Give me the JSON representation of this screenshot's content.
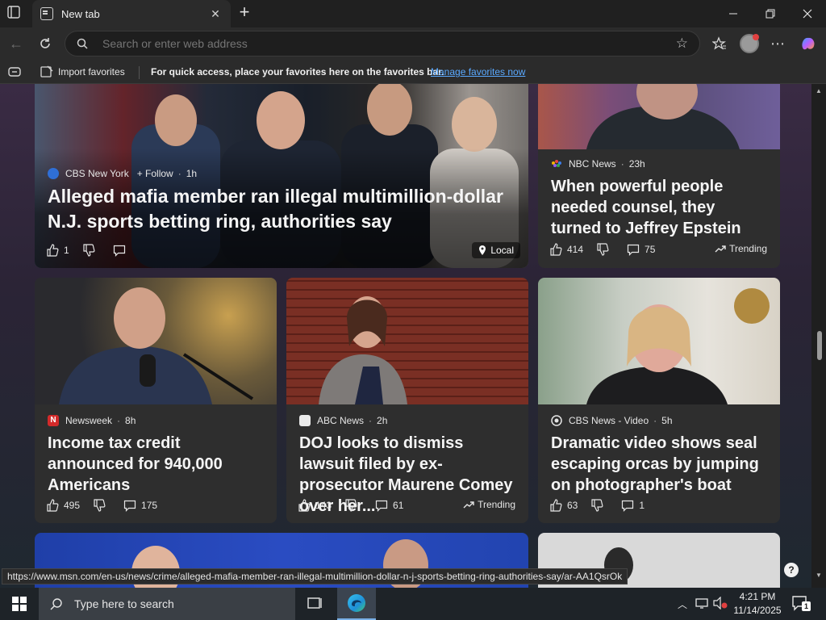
{
  "browser": {
    "tab_title": "New tab",
    "address_placeholder": "Search or enter web address"
  },
  "favorites_bar": {
    "import_label": "Import favorites",
    "message": "For quick access, place your favorites here on the favorites bar.",
    "manage_link": "Manage favorites now"
  },
  "feed": {
    "top_story": {
      "source": "CBS New York",
      "follow_label": "+ Follow",
      "time": "1h",
      "headline": "Alleged mafia member ran illegal multimillion-dollar N.J. sports betting ring, authorities say",
      "likes": "1",
      "badge": "Local"
    },
    "side_story": {
      "source": "NBC News",
      "time": "23h",
      "headline": "When powerful people needed counsel, they turned to Jeffrey Epstein",
      "likes": "414",
      "comments": "75",
      "trend": "Trending"
    },
    "card1": {
      "source": "Newsweek",
      "time": "8h",
      "headline": "Income tax credit announced for 940,000 Americans",
      "likes": "495",
      "comments": "175"
    },
    "card2": {
      "source": "ABC News",
      "time": "2h",
      "headline": "DOJ looks to dismiss lawsuit filed by ex-prosecutor Maurene Comey over her...",
      "likes": "143",
      "comments": "61",
      "trend": "Trending"
    },
    "card3": {
      "source": "CBS News - Video",
      "time": "5h",
      "headline": "Dramatic video shows seal escaping orcas by jumping on photographer's boat",
      "likes": "63",
      "comments": "1"
    }
  },
  "status_url": "https://www.msn.com/en-us/news/crime/alleged-mafia-member-ran-illegal-multimillion-dollar-n-j-sports-betting-ring-authorities-say/ar-AA1QsrOk",
  "taskbar": {
    "search_placeholder": "Type here to search",
    "time": "4:21 PM",
    "date": "11/14/2025",
    "notification_count": "1"
  },
  "colors": {
    "accent_link": "#5aa9ff",
    "card_bg": "#2e2e2e",
    "newsweek_red": "#d32a2a"
  }
}
